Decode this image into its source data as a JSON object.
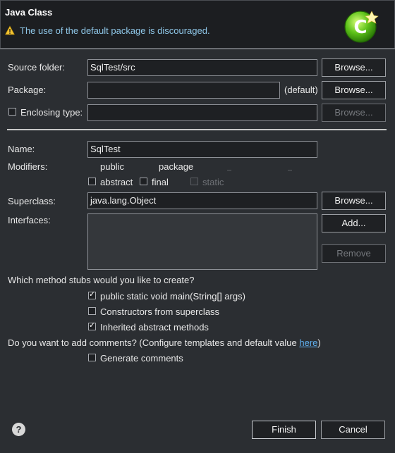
{
  "header": {
    "title": "Java Class",
    "warning": "The use of the default package is discouraged."
  },
  "form": {
    "source_folder_label": "Source folder:",
    "source_folder_value": "SqlTest/src",
    "package_label": "Package:",
    "package_value": "",
    "package_default_label": "(default)",
    "enclosing_type_label": "Enclosing type:",
    "enclosing_type_value": "",
    "browse_label": "Browse...",
    "name_label": "Name:",
    "name_value": "SqlTest",
    "modifiers_label": "Modifiers:",
    "modifier_public": "public",
    "modifier_package": "package",
    "modifier_abstract": "abstract",
    "modifier_final": "final",
    "modifier_static": "static",
    "superclass_label": "Superclass:",
    "superclass_value": "java.lang.Object",
    "interfaces_label": "Interfaces:",
    "add_label": "Add...",
    "remove_label": "Remove",
    "stubs_question": "Which method stubs would you like to create?",
    "stub_main": "public static void main(String[] args)",
    "stub_constructors": "Constructors from superclass",
    "stub_inherited": "Inherited abstract methods",
    "comments_question": "Do you want to add comments? (Configure templates and default value ",
    "comments_link": "here",
    "comments_suffix": ")",
    "generate_comments": "Generate comments"
  },
  "checkboxes": {
    "enclosing_type": false,
    "abstract": false,
    "final": false,
    "static": false,
    "stub_main": true,
    "stub_constructors": false,
    "stub_inherited": true,
    "generate_comments": false
  },
  "footer": {
    "finish_label": "Finish",
    "cancel_label": "Cancel"
  },
  "icons": {
    "warning": "warning-icon",
    "logo": "new-class-logo-icon",
    "help": "help-icon"
  }
}
